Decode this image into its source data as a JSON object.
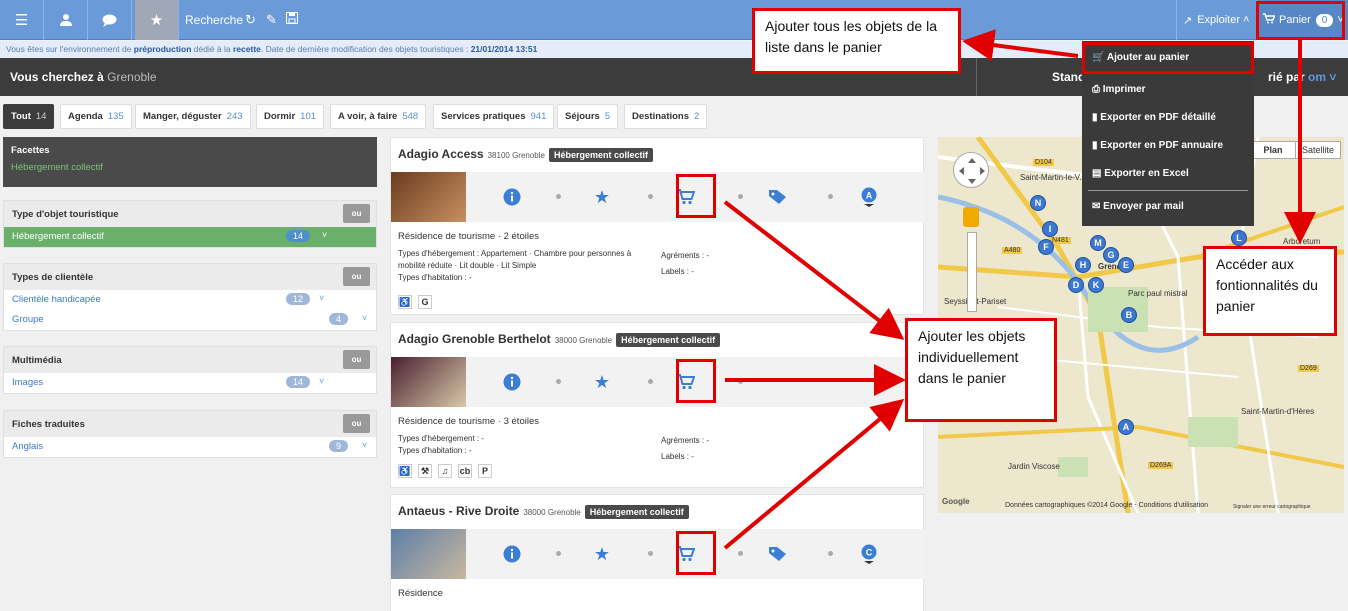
{
  "topbar": {
    "search_label": "Recherche",
    "exploiter_label": "Exploiter",
    "panier_label": "Panier",
    "panier_count": "0"
  },
  "info": {
    "prefix": "Vous êtes sur l'environnement de ",
    "env": "préproduction",
    "middle": " dédié à la ",
    "recette": "recette",
    "suffix": ". Date de dernière modification des objets touristiques : ",
    "date": "21/01/2014 13:51"
  },
  "header": {
    "search_prefix": "Vous cherchez à ",
    "city": "Grenoble",
    "sort_left": "Stand",
    "sort_right_a": "rié par ",
    "sort_right_b": "om"
  },
  "tabs": [
    {
      "label": "Tout",
      "count": "14"
    },
    {
      "label": "Agenda",
      "count": "135"
    },
    {
      "label": "Manger, déguster",
      "count": "243"
    },
    {
      "label": "Dormir",
      "count": "101"
    },
    {
      "label": "A voir, à faire",
      "count": "548"
    },
    {
      "label": "Services pratiques",
      "count": "941"
    },
    {
      "label": "Séjours",
      "count": "5"
    },
    {
      "label": "Destinations",
      "count": "2"
    }
  ],
  "facets": {
    "title": "Facettes",
    "active": "Hébergement collectif",
    "or_label": "ou",
    "groups": [
      {
        "title": "Type d'objet touristique",
        "items": [
          {
            "label": "Hébergement collectif",
            "count": "14"
          }
        ]
      },
      {
        "title": "Types de clientèle",
        "items": [
          {
            "label": "Clientèle handicapée",
            "count": "12"
          },
          {
            "label": "Groupe",
            "count": "4"
          }
        ]
      },
      {
        "title": "Multimédia",
        "items": [
          {
            "label": "Images",
            "count": "14"
          }
        ]
      },
      {
        "title": "Fiches traduites",
        "items": [
          {
            "label": "Anglais",
            "count": "9"
          }
        ]
      }
    ]
  },
  "cards": [
    {
      "name": "Adagio Access",
      "postcode": "38100 Grenoble",
      "tag": "Hébergement collectif",
      "subtitle": "Résidence de tourisme · 2 étoiles",
      "types_label": "Types d'hébergement : ",
      "types_value": "Appartement · Chambre pour personnes à mobilité réduite · Lit double · Lit Simple",
      "habitation": "Types d'habitation : -",
      "agrements": "Agréments : -",
      "labels": "Labels : -",
      "map_pin": "A"
    },
    {
      "name": "Adagio Grenoble Berthelot",
      "postcode": "38000 Grenoble",
      "tag": "Hébergement collectif",
      "subtitle": "Résidence de tourisme · 3 étoiles",
      "types_label": "Types d'hébergement : ",
      "types_value": "-",
      "habitation": "Types d'habitation : -",
      "agrements": "Agréments : -",
      "labels": "Labels : -"
    },
    {
      "name": "Antaeus - Rive Droite",
      "postcode": "38000 Grenoble",
      "tag": "Hébergement collectif",
      "subtitle": "Résidence",
      "map_pin": "C"
    }
  ],
  "dropdown": {
    "items": [
      "Ajouter au panier",
      "Imprimer",
      "Exporter en PDF détaillé",
      "Exporter en PDF annuaire",
      "Exporter en Excel",
      "Envoyer par mail"
    ]
  },
  "map": {
    "plan": "Plan",
    "satellite": "Satellite",
    "places": [
      "Saint-Martin-le-V...",
      "Seyssinet-Pariset",
      "Saint-Martin-d'Hères",
      "Jardin Viscose",
      "Parc paul mistral",
      "Grenoble",
      "Arboretum",
      "Grenoble"
    ],
    "footer": "Données cartographiques ©2014 Google - Conditions d'utilisation",
    "report": "Signaler une erreur cartographique",
    "logo": "Google"
  },
  "annotations": {
    "top": "Ajouter tous les objets de la liste dans le panier",
    "right": "Accéder aux fontionnalités du panier",
    "middle": "Ajouter les objets individuellement dans le panier"
  },
  "colors": {
    "accent": "#6b9ad8",
    "annotation_red": "#e10000",
    "facet_green": "#6ab06a"
  }
}
